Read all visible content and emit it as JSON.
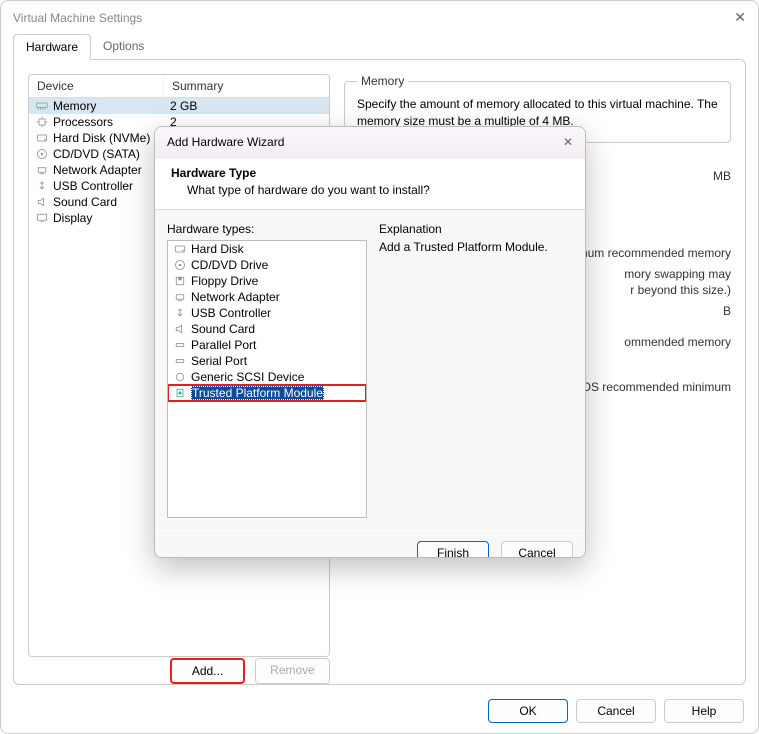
{
  "window": {
    "title": "Virtual Machine Settings"
  },
  "tabs": {
    "hardware": "Hardware",
    "options": "Options"
  },
  "table": {
    "col1": "Device",
    "col2": "Summary",
    "rows": [
      {
        "name": "Memory",
        "summary": "2 GB",
        "icon": "memory-icon",
        "sel": true
      },
      {
        "name": "Processors",
        "summary": "2",
        "icon": "cpu-icon"
      },
      {
        "name": "Hard Disk (NVMe)",
        "summary": "",
        "icon": "disk-icon"
      },
      {
        "name": "CD/DVD (SATA)",
        "summary": "",
        "icon": "disc-icon"
      },
      {
        "name": "Network Adapter",
        "summary": "",
        "icon": "network-icon"
      },
      {
        "name": "USB Controller",
        "summary": "",
        "icon": "usb-icon"
      },
      {
        "name": "Sound Card",
        "summary": "",
        "icon": "sound-icon"
      },
      {
        "name": "Display",
        "summary": "",
        "icon": "display-icon"
      }
    ]
  },
  "memory": {
    "legend": "Memory",
    "desc": "Specify the amount of memory allocated to this virtual machine. The memory size must be a multiple of 4 MB.",
    "mb_suffix": "MB",
    "line1a": "mum recommended memory",
    "line2a": "mory swapping may",
    "line2b": "r beyond this size.)",
    "valB": "B",
    "line3": "ommended memory",
    "line4": "st OS recommended minimum"
  },
  "buttons": {
    "add": "Add...",
    "remove": "Remove",
    "ok": "OK",
    "cancel": "Cancel",
    "help": "Help"
  },
  "wizard": {
    "title": "Add Hardware Wizard",
    "head_title": "Hardware Type",
    "head_desc": "What type of hardware do you want to install?",
    "list_label": "Hardware types:",
    "explain_label": "Explanation",
    "explain_text": "Add a Trusted Platform Module.",
    "items": [
      {
        "label": "Hard Disk",
        "icon": "disk-icon"
      },
      {
        "label": "CD/DVD Drive",
        "icon": "disc-icon"
      },
      {
        "label": "Floppy Drive",
        "icon": "floppy-icon"
      },
      {
        "label": "Network Adapter",
        "icon": "network-icon"
      },
      {
        "label": "USB Controller",
        "icon": "usb-icon"
      },
      {
        "label": "Sound Card",
        "icon": "sound-icon"
      },
      {
        "label": "Parallel Port",
        "icon": "port-icon"
      },
      {
        "label": "Serial Port",
        "icon": "port-icon"
      },
      {
        "label": "Generic SCSI Device",
        "icon": "scsi-icon"
      },
      {
        "label": "Trusted Platform Module",
        "icon": "tpm-icon",
        "sel": true,
        "boxed": true
      }
    ],
    "finish": "Finish",
    "cancel": "Cancel"
  }
}
